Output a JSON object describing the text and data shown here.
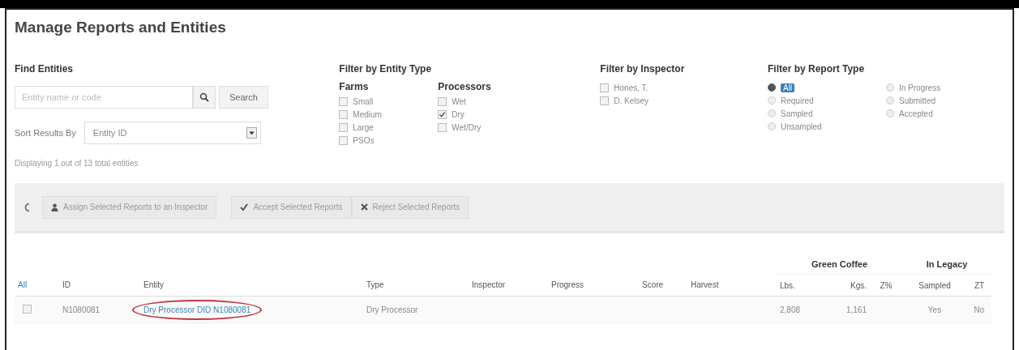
{
  "page": {
    "title": "Manage Reports and Entities"
  },
  "find": {
    "heading": "Find Entities",
    "placeholder": "Entity name or code",
    "search_button": "Search",
    "sort_label": "Sort Results By",
    "sort_value": "Entity ID"
  },
  "entity_type": {
    "heading": "Filter by Entity Type",
    "groups": [
      {
        "title": "Farms",
        "options": [
          {
            "label": "Small",
            "checked": false
          },
          {
            "label": "Medium",
            "checked": false
          },
          {
            "label": "Large",
            "checked": false
          },
          {
            "label": "PSOs",
            "checked": false
          }
        ]
      },
      {
        "title": "Processors",
        "options": [
          {
            "label": "Wet",
            "checked": false
          },
          {
            "label": "Dry",
            "checked": true
          },
          {
            "label": "Wet/Dry",
            "checked": false
          }
        ]
      }
    ]
  },
  "inspector": {
    "heading": "Filter by Inspector",
    "options": [
      {
        "label": "Hones, T.",
        "checked": false
      },
      {
        "label": "D. Kelsey",
        "checked": false
      }
    ]
  },
  "report_type": {
    "heading": "Filter by Report Type",
    "options": [
      {
        "label": "All",
        "selected": true
      },
      {
        "label": "Required",
        "selected": false
      },
      {
        "label": "Sampled",
        "selected": false
      },
      {
        "label": "Unsampled",
        "selected": false
      },
      {
        "label": "In Progress",
        "selected": false
      },
      {
        "label": "Submitted",
        "selected": false
      },
      {
        "label": "Accepted",
        "selected": false
      }
    ]
  },
  "summary": "Displaying 1 out of 13 total entities",
  "actions": [
    {
      "kind": "assign",
      "label": "Assign Selected Reports to an Inspector"
    },
    {
      "kind": "accept",
      "label": "Accept Selected Reports"
    },
    {
      "kind": "reject",
      "label": "Reject Selected Reports"
    }
  ],
  "table": {
    "group_headers": [
      {
        "label": "Green Coffee"
      },
      {
        "label": "In Legacy"
      }
    ],
    "select_all": "All",
    "columns": [
      "ID",
      "Entity",
      "Type",
      "Inspector",
      "Progress",
      "Score",
      "Harvest",
      "Lbs.",
      "Kgs.",
      "Z%",
      "Sampled",
      "ZT"
    ],
    "rows": [
      {
        "checked": false,
        "cells": [
          "N1080081",
          "Dry Processor DID N1080081",
          "Dry Processor",
          "",
          "",
          "",
          "",
          "2,808",
          "1,161",
          "",
          "Yes",
          "No"
        ]
      }
    ]
  }
}
